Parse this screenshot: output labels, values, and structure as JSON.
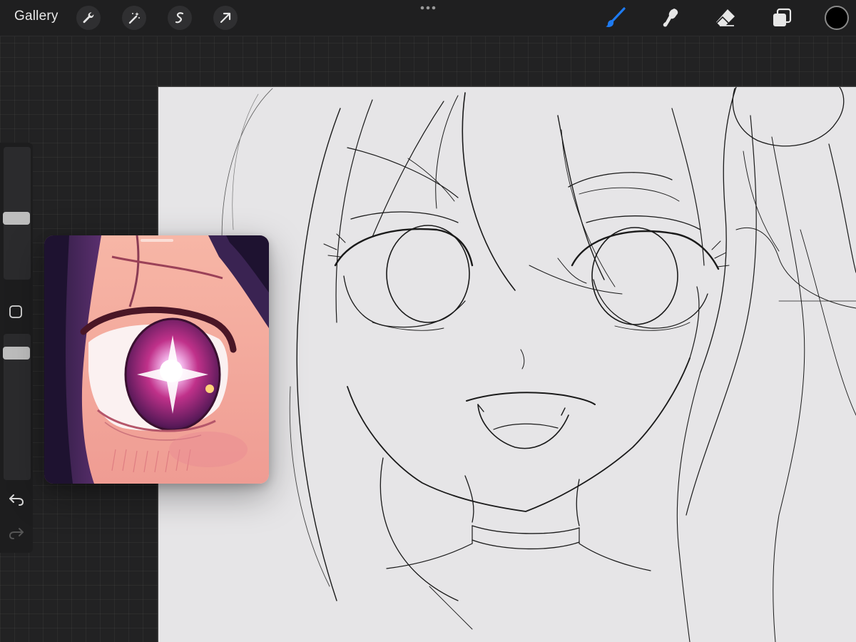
{
  "app": {
    "gallery_label": "Gallery"
  },
  "toolbar": {
    "left_tools": [
      {
        "name": "actions",
        "icon": "wrench-icon"
      },
      {
        "name": "adjustments",
        "icon": "magic-wand-icon"
      },
      {
        "name": "selection",
        "icon": "selection-s-icon"
      },
      {
        "name": "transform",
        "icon": "arrow-cursor-icon"
      }
    ],
    "right_tools": [
      {
        "name": "brush",
        "icon": "brush-icon",
        "active": true
      },
      {
        "name": "smudge",
        "icon": "smudge-icon",
        "active": false
      },
      {
        "name": "eraser",
        "icon": "eraser-icon",
        "active": false
      },
      {
        "name": "layers",
        "icon": "layers-icon",
        "active": false
      }
    ],
    "active_color": "#000000",
    "accent_color": "#1e7bf2"
  },
  "sidebar": {
    "brush_size_level": 0.62,
    "opacity_level": 0.65,
    "buttons": [
      "modify-button",
      "undo-button",
      "redo-button"
    ]
  },
  "reference": {
    "subject": "anime-eye-closeup",
    "colors": {
      "skin": "#f2a89a",
      "iris": "#c0318a",
      "hair": "#3b2150"
    }
  },
  "canvas": {
    "background": "#e6e5e7",
    "content": "line-sketch-anime-girl-face"
  }
}
